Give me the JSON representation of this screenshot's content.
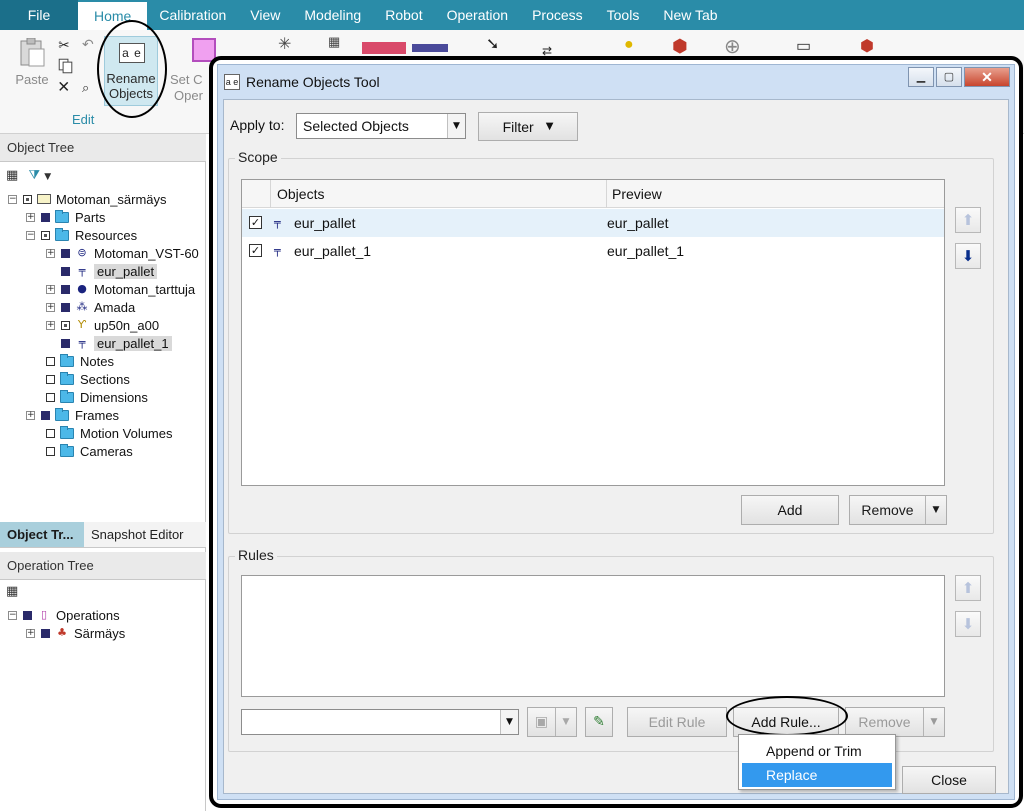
{
  "menubar": {
    "file": "File",
    "tabs": [
      "Home",
      "Calibration",
      "View",
      "Modeling",
      "Robot",
      "Operation",
      "Process",
      "Tools",
      "New Tab"
    ]
  },
  "ribbon": {
    "paste_label": "Paste",
    "rename_icon_text": "a e",
    "rename_label_1": "Rename",
    "rename_label_2": "Objects",
    "setc_label_1": "Set C",
    "setc_label_2": "Oper",
    "edit_group": "Edit"
  },
  "object_tree": {
    "header": "Object Tree",
    "items": [
      {
        "label": "Motoman_särmäys",
        "icon": "study-icon"
      },
      {
        "label": "Parts",
        "icon": "folder-icon"
      },
      {
        "label": "Resources",
        "icon": "folder-icon"
      },
      {
        "label": "Motoman_VST-60",
        "icon": "tool-icon"
      },
      {
        "label": "eur_pallet",
        "icon": "pallet-icon"
      },
      {
        "label": "Motoman_tarttuja",
        "icon": "gripper-icon"
      },
      {
        "label": "Amada",
        "icon": "device-icon"
      },
      {
        "label": "up50n_a00",
        "icon": "robot-icon"
      },
      {
        "label": "eur_pallet_1",
        "icon": "pallet-icon"
      },
      {
        "label": "Notes",
        "icon": "folder-icon"
      },
      {
        "label": "Sections",
        "icon": "folder-icon"
      },
      {
        "label": "Dimensions",
        "icon": "folder-icon"
      },
      {
        "label": "Frames",
        "icon": "folder-icon"
      },
      {
        "label": "Motion Volumes",
        "icon": "folder-icon"
      },
      {
        "label": "Cameras",
        "icon": "folder-icon"
      }
    ]
  },
  "bottom_tabs": {
    "active": "Object Tr...",
    "inactive": "Snapshot Editor"
  },
  "operation_tree": {
    "header": "Operation Tree",
    "items": [
      {
        "label": "Operations",
        "icon": "operations-icon"
      },
      {
        "label": "Särmäys",
        "icon": "compound-operation-icon"
      }
    ]
  },
  "dialog": {
    "title": "Rename Objects Tool",
    "title_icon": "a e",
    "apply_to_label": "Apply to:",
    "apply_to_value": "Selected Objects",
    "filter_label": "Filter",
    "scope": {
      "title": "Scope",
      "columns": [
        "Objects",
        "Preview"
      ],
      "rows": [
        {
          "checked": true,
          "object": "eur_pallet",
          "preview": "eur_pallet"
        },
        {
          "checked": true,
          "object": "eur_pallet_1",
          "preview": "eur_pallet_1"
        }
      ],
      "add_label": "Add",
      "remove_label": "Remove"
    },
    "rules": {
      "title": "Rules",
      "rule_select_value": "",
      "edit_rule_label": "Edit Rule",
      "add_rule_label": "Add Rule...",
      "remove_label": "Remove"
    },
    "close_label": "Close",
    "add_rule_menu": {
      "items": [
        "Append or Trim",
        "Replace"
      ],
      "highlighted": "Replace"
    }
  }
}
